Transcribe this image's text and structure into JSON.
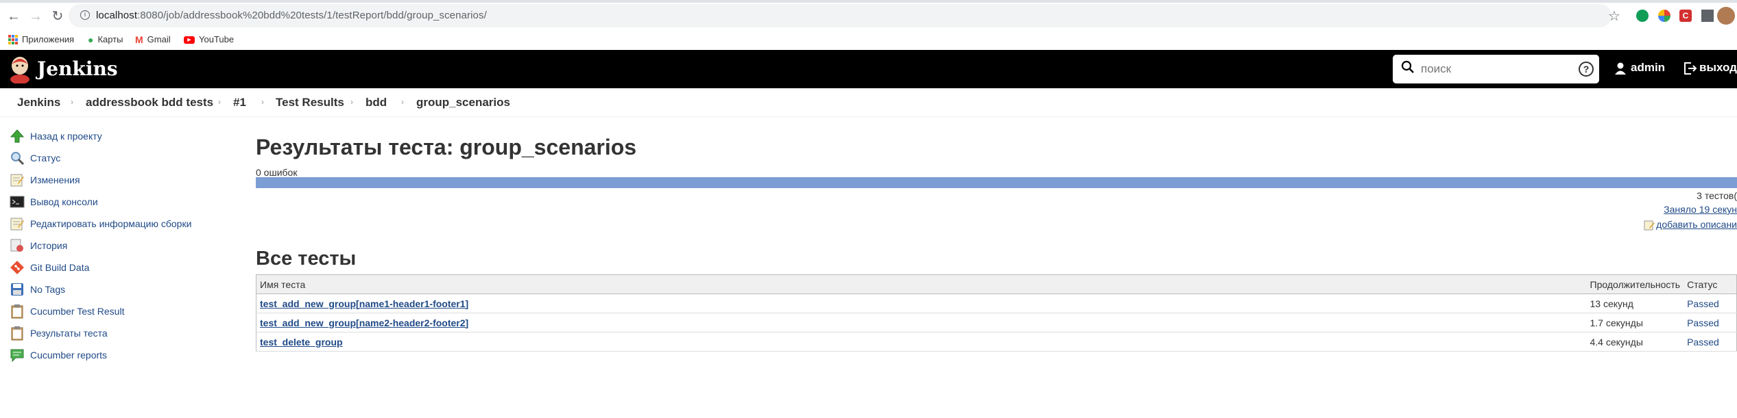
{
  "browser": {
    "url_host": "localhost",
    "url_path": ":8080/job/addressbook%20bdd%20tests/1/testReport/bdd/group_scenarios/",
    "bookmarks": [
      {
        "label": "Приложения",
        "icon": "apps-grid-icon"
      },
      {
        "label": "Карты",
        "icon": "maps-icon"
      },
      {
        "label": "Gmail",
        "icon": "gmail-icon"
      },
      {
        "label": "YouTube",
        "icon": "youtube-icon"
      }
    ]
  },
  "header": {
    "logo": "Jenkins",
    "search_placeholder": "поиск",
    "user": "admin",
    "logout": "выход"
  },
  "breadcrumb": [
    "Jenkins",
    "addressbook bdd tests",
    "#1",
    "Test Results",
    "bdd",
    "group_scenarios"
  ],
  "sidebar": {
    "items": [
      {
        "label": "Назад к проекту",
        "icon": "up-arrow-icon"
      },
      {
        "label": "Статус",
        "icon": "search-icon"
      },
      {
        "label": "Изменения",
        "icon": "notepad-icon"
      },
      {
        "label": "Вывод консоли",
        "icon": "terminal-icon"
      },
      {
        "label": "Редактировать информацию сборки",
        "icon": "notepad-icon"
      },
      {
        "label": "История",
        "icon": "history-icon"
      },
      {
        "label": "Git Build Data",
        "icon": "git-icon"
      },
      {
        "label": "No Tags",
        "icon": "save-icon"
      },
      {
        "label": "Cucumber Test Result",
        "icon": "clipboard-icon"
      },
      {
        "label": "Результаты теста",
        "icon": "clipboard-icon"
      },
      {
        "label": "Cucumber reports",
        "icon": "chat-icon"
      }
    ]
  },
  "main": {
    "title": "Результаты теста: group_scenarios",
    "fail_count": "0 ошибок",
    "pass_fraction": 1.0,
    "tests_count": "3 тестов(",
    "duration_link": "Заняло 19 секун",
    "add_description": "добавить описани",
    "all_tests_heading": "Все тесты",
    "table": {
      "headers": [
        "Имя теста",
        "Продолжительность",
        "Статус"
      ],
      "rows": [
        {
          "name": "test_add_new_group[name1-header1-footer1]",
          "duration": "13 секунд",
          "status": "Passed"
        },
        {
          "name": "test_add_new_group[name2-header2-footer2]",
          "duration": "1.7 секунды",
          "status": "Passed"
        },
        {
          "name": "test_delete_group",
          "duration": "4.4 секунды",
          "status": "Passed"
        }
      ]
    }
  }
}
